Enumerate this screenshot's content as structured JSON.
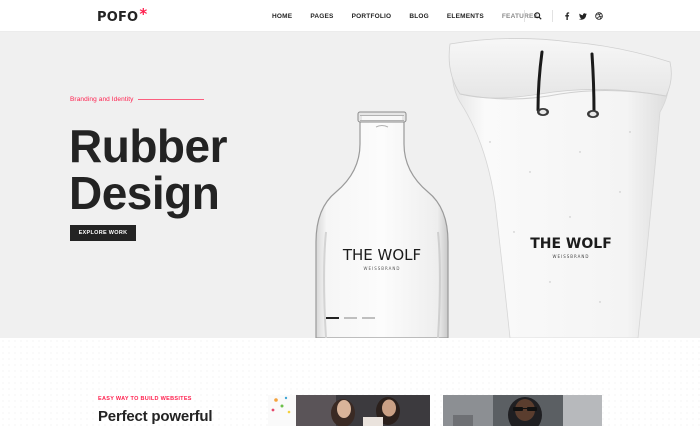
{
  "header": {
    "logo_text": "POFO",
    "logo_mark": "*",
    "nav": [
      {
        "label": "HOME"
      },
      {
        "label": "PAGES"
      },
      {
        "label": "PORTFOLIO"
      },
      {
        "label": "BLOG"
      },
      {
        "label": "ELEMENTS"
      },
      {
        "label": "FEATURES"
      }
    ],
    "icons": [
      "search-icon",
      "facebook-icon",
      "twitter-icon",
      "dribbble-icon"
    ]
  },
  "hero": {
    "tagline": "Branding and Identity",
    "title_line1": "Rubber",
    "title_line2": "Design",
    "cta": "EXPLORE WORK",
    "bottle_brand": "THE WOLF",
    "bottle_sub": "WEISSBRAND",
    "bag_brand": "THE WOLF",
    "bag_sub": "WEISSBRAND",
    "slides_total": 3,
    "slide_active": 1
  },
  "section": {
    "eyebrow": "EASY WAY TO BUILD WEBSITES",
    "title": "Perfect powerful"
  },
  "colors": {
    "accent": "#ff214f",
    "dark": "#232323",
    "hero_bg": "#f0f0f0"
  }
}
